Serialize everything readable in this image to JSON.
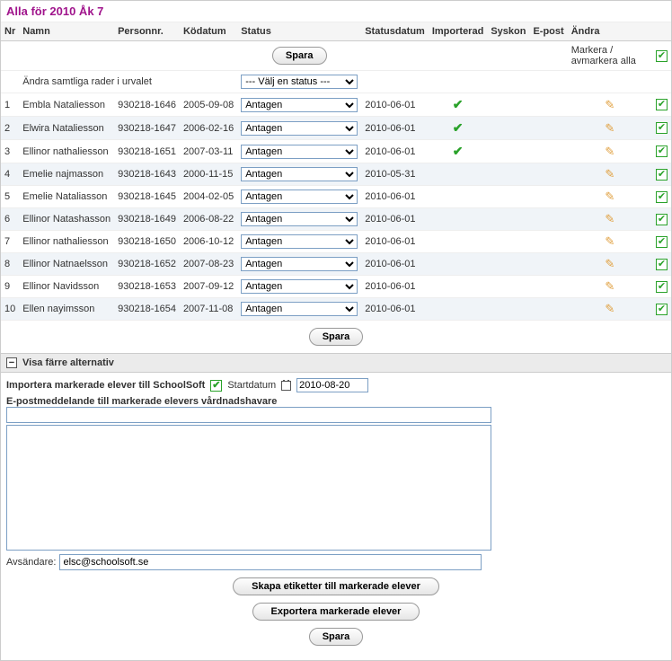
{
  "title": "Alla för 2010 Åk 7",
  "columns": {
    "nr": "Nr",
    "namn": "Namn",
    "personnr": "Personnr.",
    "kodatum": "Ködatum",
    "status": "Status",
    "statusdatum": "Statusdatum",
    "importerad": "Importerad",
    "syskon": "Syskon",
    "epost": "E-post",
    "andra": "Ändra"
  },
  "save_label": "Spara",
  "mark_all_label": "Markera / avmarkera alla",
  "bulk_change_label": "Ändra samtliga rader i urvalet",
  "bulk_status_placeholder": "--- Välj en status ---",
  "rows": [
    {
      "nr": "1",
      "namn": "Embla Nataliesson",
      "personnr": "930218-1646",
      "kodatum": "2005-09-08",
      "status": "Antagen",
      "statusdatum": "2010-06-01",
      "importerad": true,
      "alt": false
    },
    {
      "nr": "2",
      "namn": "Elwira Nataliesson",
      "personnr": "930218-1647",
      "kodatum": "2006-02-16",
      "status": "Antagen",
      "statusdatum": "2010-06-01",
      "importerad": true,
      "alt": true
    },
    {
      "nr": "3",
      "namn": "Ellinor nathaliesson",
      "personnr": "930218-1651",
      "kodatum": "2007-03-11",
      "status": "Antagen",
      "statusdatum": "2010-06-01",
      "importerad": true,
      "alt": false
    },
    {
      "nr": "4",
      "namn": "Emelie najmasson",
      "personnr": "930218-1643",
      "kodatum": "2000-11-15",
      "status": "Antagen",
      "statusdatum": "2010-05-31",
      "importerad": false,
      "alt": true
    },
    {
      "nr": "5",
      "namn": "Emelie Nataliasson",
      "personnr": "930218-1645",
      "kodatum": "2004-02-05",
      "status": "Antagen",
      "statusdatum": "2010-06-01",
      "importerad": false,
      "alt": false
    },
    {
      "nr": "6",
      "namn": "Ellinor Natashasson",
      "personnr": "930218-1649",
      "kodatum": "2006-08-22",
      "status": "Antagen",
      "statusdatum": "2010-06-01",
      "importerad": false,
      "alt": true
    },
    {
      "nr": "7",
      "namn": "Ellinor nathaliesson",
      "personnr": "930218-1650",
      "kodatum": "2006-10-12",
      "status": "Antagen",
      "statusdatum": "2010-06-01",
      "importerad": false,
      "alt": false
    },
    {
      "nr": "8",
      "namn": "Ellinor Natnaelsson",
      "personnr": "930218-1652",
      "kodatum": "2007-08-23",
      "status": "Antagen",
      "statusdatum": "2010-06-01",
      "importerad": false,
      "alt": true
    },
    {
      "nr": "9",
      "namn": "Ellinor Navidsson",
      "personnr": "930218-1653",
      "kodatum": "2007-09-12",
      "status": "Antagen",
      "statusdatum": "2010-06-01",
      "importerad": false,
      "alt": false
    },
    {
      "nr": "10",
      "namn": "Ellen nayimsson",
      "personnr": "930218-1654",
      "kodatum": "2007-11-08",
      "status": "Antagen",
      "statusdatum": "2010-06-01",
      "importerad": false,
      "alt": true
    }
  ],
  "fewer_options_label": "Visa färre alternativ",
  "import_label": "Importera markerade elever till SchoolSoft",
  "startdate_label": "Startdatum",
  "startdate_value": "2010-08-20",
  "email_label": "E-postmeddelande till markerade elevers vårdnadshavare",
  "sender_label": "Avsändare:",
  "sender_value": "elsc@schoolsoft.se",
  "labels_button": "Skapa etiketter till markerade elever",
  "export_button": "Exportera markerade elever"
}
